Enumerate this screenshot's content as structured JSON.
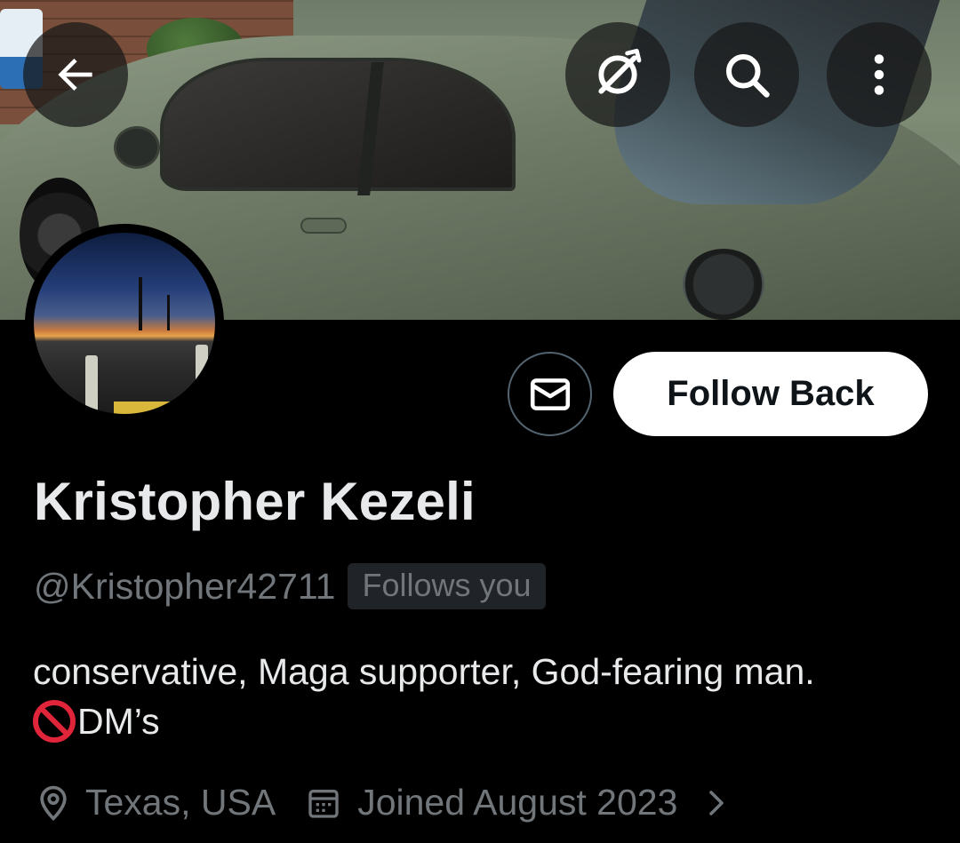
{
  "header": {
    "back_label": "Back",
    "icons": [
      "back-arrow-icon",
      "grok-icon",
      "search-icon",
      "more-vertical-icon"
    ]
  },
  "banner": {
    "description_icon": "car-photo"
  },
  "actions": {
    "message_icon": "envelope-icon",
    "follow_back_label": "Follow Back"
  },
  "profile": {
    "display_name": "Kristopher Kezeli",
    "handle": "@Kristopher42711",
    "follows_you_badge": "Follows you",
    "bio_line1": "conservative, Maga supporter, God-fearing man.",
    "bio_line2_emoji": "🚫",
    "bio_line2_text": "DM’s",
    "location": "Texas, USA",
    "joined": "Joined August 2023"
  },
  "colors": {
    "background": "#000000",
    "primary_text": "#e7e9ea",
    "secondary_text": "#71767b",
    "button_bg": "#ffffff",
    "button_text": "#0f1419",
    "prohibited_red": "#e0243a"
  }
}
